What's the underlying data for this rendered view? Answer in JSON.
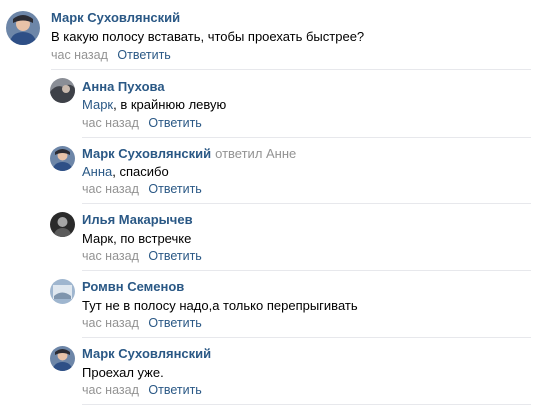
{
  "comments": [
    {
      "author": "Марк Суховлянский",
      "reply_to": "",
      "addressee": "",
      "text": "В какую полосу вставать, чтобы проехать быстрее?",
      "time": "час назад",
      "reply_label": "Ответить",
      "avatar": "avatar-mark"
    },
    {
      "author": "Анна Пухова",
      "reply_to": "",
      "addressee": "Марк",
      "text": ", в крайнюю левую",
      "time": "час назад",
      "reply_label": "Ответить",
      "avatar": "avatar-anna"
    },
    {
      "author": "Марк Суховлянский",
      "reply_to": "ответил Анне",
      "addressee": "Анна",
      "text": ", спасибо",
      "time": "час назад",
      "reply_label": "Ответить",
      "avatar": "avatar-mark"
    },
    {
      "author": "Илья Макарычев",
      "reply_to": "",
      "addressee": "",
      "text": "Марк, по встречке",
      "time": "час назад",
      "reply_label": "Ответить",
      "avatar": "avatar-ilya"
    },
    {
      "author": "Ромвн Семенов",
      "reply_to": "",
      "addressee": "",
      "text": "Тут не в полосу надо,а только перепрыгивать",
      "time": "час назад",
      "reply_label": "Ответить",
      "avatar": "avatar-roman"
    },
    {
      "author": "Марк Суховлянский",
      "reply_to": "",
      "addressee": "",
      "text": "Проехал уже.",
      "time": "час назад",
      "reply_label": "Ответить",
      "avatar": "avatar-mark"
    }
  ],
  "colors": {
    "author": "#2a5885",
    "meta": "#939393",
    "divider": "#e7e8ec"
  }
}
